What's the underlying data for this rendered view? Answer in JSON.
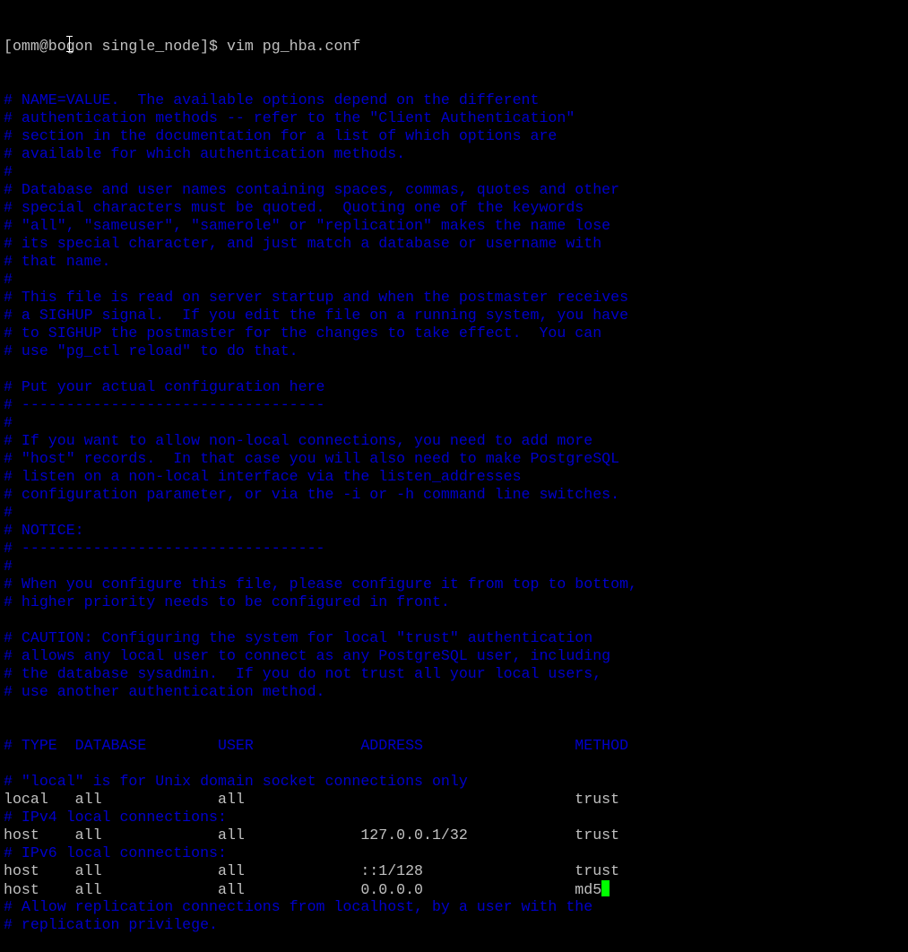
{
  "terminal": {
    "prompt": "[omm@bogon single_node]$ vim pg_hba.conf",
    "colors": {
      "background": "#000000",
      "foreground": "#c0c0c0",
      "comment": "#0000cc",
      "cursor": "#00ff00"
    },
    "lines": [
      {
        "kind": "comment",
        "text": "# NAME=VALUE.  The available options depend on the different"
      },
      {
        "kind": "comment",
        "text": "# authentication methods -- refer to the \"Client Authentication\""
      },
      {
        "kind": "comment",
        "text": "# section in the documentation for a list of which options are"
      },
      {
        "kind": "comment",
        "text": "# available for which authentication methods."
      },
      {
        "kind": "comment",
        "text": "#"
      },
      {
        "kind": "comment",
        "text": "# Database and user names containing spaces, commas, quotes and other"
      },
      {
        "kind": "comment",
        "text": "# special characters must be quoted.  Quoting one of the keywords"
      },
      {
        "kind": "comment",
        "text": "# \"all\", \"sameuser\", \"samerole\" or \"replication\" makes the name lose"
      },
      {
        "kind": "comment",
        "text": "# its special character, and just match a database or username with"
      },
      {
        "kind": "comment",
        "text": "# that name."
      },
      {
        "kind": "comment",
        "text": "#"
      },
      {
        "kind": "comment",
        "text": "# This file is read on server startup and when the postmaster receives"
      },
      {
        "kind": "comment",
        "text": "# a SIGHUP signal.  If you edit the file on a running system, you have"
      },
      {
        "kind": "comment",
        "text": "# to SIGHUP the postmaster for the changes to take effect.  You can"
      },
      {
        "kind": "comment",
        "text": "# use \"pg_ctl reload\" to do that."
      },
      {
        "kind": "blank",
        "text": ""
      },
      {
        "kind": "comment",
        "text": "# Put your actual configuration here"
      },
      {
        "kind": "comment",
        "text": "# ----------------------------------"
      },
      {
        "kind": "comment",
        "text": "#"
      },
      {
        "kind": "comment",
        "text": "# If you want to allow non-local connections, you need to add more"
      },
      {
        "kind": "comment",
        "text": "# \"host\" records.  In that case you will also need to make PostgreSQL"
      },
      {
        "kind": "comment",
        "text": "# listen on a non-local interface via the listen_addresses"
      },
      {
        "kind": "comment",
        "text": "# configuration parameter, or via the -i or -h command line switches."
      },
      {
        "kind": "comment",
        "text": "#"
      },
      {
        "kind": "comment",
        "text": "# NOTICE:"
      },
      {
        "kind": "comment",
        "text": "# ----------------------------------"
      },
      {
        "kind": "comment",
        "text": "#"
      },
      {
        "kind": "comment",
        "text": "# When you configure this file, please configure it from top to bottom,"
      },
      {
        "kind": "comment",
        "text": "# higher priority needs to be configured in front."
      },
      {
        "kind": "blank",
        "text": ""
      },
      {
        "kind": "comment",
        "text": "# CAUTION: Configuring the system for local \"trust\" authentication"
      },
      {
        "kind": "comment",
        "text": "# allows any local user to connect as any PostgreSQL user, including"
      },
      {
        "kind": "comment",
        "text": "# the database sysadmin.  If you do not trust all your local users,"
      },
      {
        "kind": "comment",
        "text": "# use another authentication method."
      },
      {
        "kind": "blank",
        "text": ""
      },
      {
        "kind": "blank",
        "text": ""
      },
      {
        "kind": "comment",
        "text": "# TYPE  DATABASE        USER            ADDRESS                 METHOD"
      },
      {
        "kind": "blank",
        "text": ""
      },
      {
        "kind": "comment",
        "text": "# \"local\" is for Unix domain socket connections only"
      },
      {
        "kind": "config",
        "text": "local   all             all                                     trust"
      },
      {
        "kind": "comment",
        "text": "# IPv4 local connections:"
      },
      {
        "kind": "config",
        "text": "host    all             all             127.0.0.1/32            trust"
      },
      {
        "kind": "comment",
        "text": "# IPv6 local connections:"
      },
      {
        "kind": "config",
        "text": "host    all             all             ::1/128                 trust"
      },
      {
        "kind": "config-cursor",
        "text": "host    all             all             0.0.0.0                 md5"
      },
      {
        "kind": "comment",
        "text": "# Allow replication connections from localhost, by a user with the"
      },
      {
        "kind": "comment",
        "text": "# replication privilege."
      }
    ]
  }
}
